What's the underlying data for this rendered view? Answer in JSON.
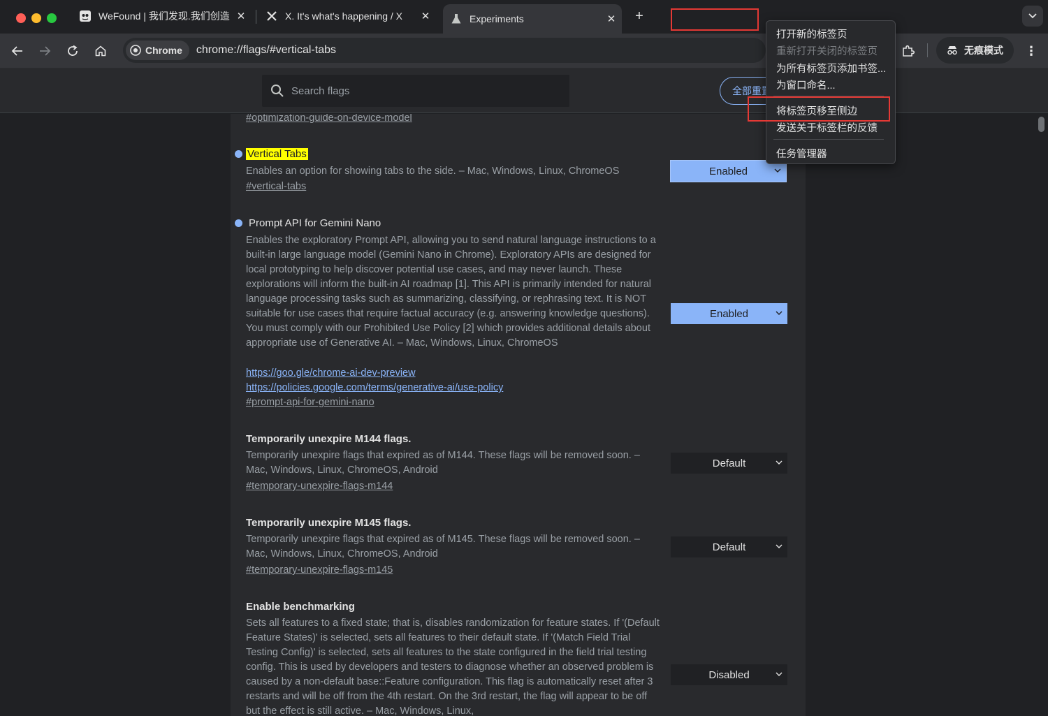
{
  "tabs": [
    {
      "title": "WeFound | 我们发现.我们创造",
      "icon": "wefound-icon"
    },
    {
      "title": "X. It's what's happening / X",
      "icon": "x-logo-icon"
    },
    {
      "title": "Experiments",
      "icon": "flask-icon",
      "active": true
    }
  ],
  "toolbar": {
    "chip_label": "Chrome",
    "url": "chrome://flags/#vertical-tabs",
    "incognito_label": "无痕模式"
  },
  "flags_header": {
    "search_placeholder": "Search flags",
    "reset_label": "全部重置"
  },
  "flags": {
    "top_link": "#optimization-guide-on-device-model",
    "vertical_tabs": {
      "title": "Vertical Tabs",
      "desc": "Enables an option for showing tabs to the side. – Mac, Windows, Linux, ChromeOS",
      "link": "#vertical-tabs",
      "value": "Enabled"
    },
    "prompt_api": {
      "title": "Prompt API for Gemini Nano",
      "desc": "Enables the exploratory Prompt API, allowing you to send natural language instructions to a built-in large language model (Gemini Nano in Chrome). Exploratory APIs are designed for local prototyping to help discover potential use cases, and may never launch. These explorations will inform the built-in AI roadmap [1]. This API is primarily intended for natural language processing tasks such as summarizing, classifying, or rephrasing text. It is NOT suitable for use cases that require factual accuracy (e.g. answering knowledge questions). You must comply with our Prohibited Use Policy [2] which provides additional details about appropriate use of Generative AI. – Mac, Windows, Linux, ChromeOS",
      "links": [
        "https://goo.gle/chrome-ai-dev-preview",
        "https://policies.google.com/terms/generative-ai/use-policy"
      ],
      "link": "#prompt-api-for-gemini-nano",
      "value": "Enabled"
    },
    "m144": {
      "title": "Temporarily unexpire M144 flags.",
      "desc": "Temporarily unexpire flags that expired as of M144. These flags will be removed soon. – Mac, Windows, Linux, ChromeOS, Android",
      "link": "#temporary-unexpire-flags-m144",
      "value": "Default"
    },
    "m145": {
      "title": "Temporarily unexpire M145 flags.",
      "desc": "Temporarily unexpire flags that expired as of M145. These flags will be removed soon. – Mac, Windows, Linux, ChromeOS, Android",
      "link": "#temporary-unexpire-flags-m145",
      "value": "Default"
    },
    "benchmarking": {
      "title": "Enable benchmarking",
      "desc": "Sets all features to a fixed state; that is, disables randomization for feature states. If '(Default Feature States)' is selected, sets all features to their default state. If '(Match Field Trial Testing Config)' is selected, sets all features to the state configured in the field trial testing config. This is used by developers and testers to diagnose whether an observed problem is caused by a non-default base::Feature configuration. This flag is automatically reset after 3 restarts and will be off from the 4th restart. On the 3rd restart, the flag will appear to be off but the effect is still active. – Mac, Windows, Linux,",
      "value": "Disabled"
    }
  },
  "context_menu": {
    "items": [
      "打开新的标签页",
      "重新打开关闭的标签页",
      "为所有标签页添加书签...",
      "为窗口命名...",
      "将标签页移至侧边",
      "发送关于标签栏的反馈",
      "任务管理器"
    ]
  },
  "colors": {
    "accent": "#8ab4f8",
    "highlight": "#ffff00",
    "annotation_red": "#e53935"
  }
}
